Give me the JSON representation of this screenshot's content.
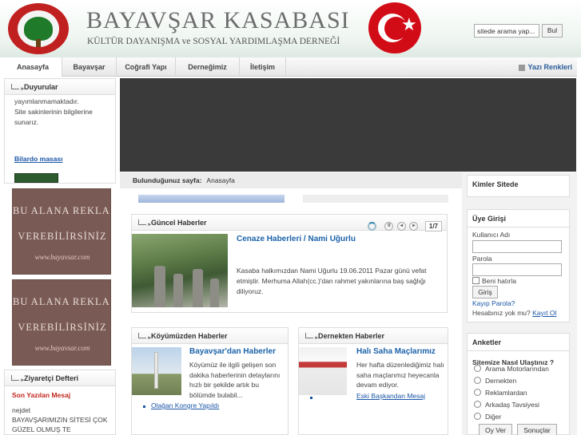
{
  "header": {
    "title": "BAYAVŞAR KASABASI",
    "subtitle": "KÜLTÜR DAYANIŞMA ve SOSYAL YARDIMLAŞMA DERNEĞİ",
    "search_placeholder": "sitede arama yap...",
    "search_button": "Bul"
  },
  "nav": {
    "items": [
      "Anasayfa",
      "Bayavşar",
      "Coğrafi Yapı",
      "Derneğimiz",
      "İletişim"
    ],
    "text_colors_label": "Yazı Renkleri"
  },
  "left": {
    "announcements_title": "Duyurular",
    "announcement_lines": [
      "yayımlanmamaktadır.",
      "Site sakinlerinin bilgilerine",
      "sunarız."
    ],
    "announcement_link": "Bilardo masası",
    "ad": {
      "line1": "BU ALANA REKLAM",
      "line2": "VEREBİLİRSİNİZ",
      "url": "www.bayavsar.com"
    },
    "guestbook_title": "Ziyaretçi Defteri",
    "guestbook_sub": "Son Yazılan Mesaj",
    "guestbook_author": "nejdet",
    "guestbook_msg": "BAYAVŞARIMIZIN SİTESİ ÇOK GÜZEL OLMUŞ TE"
  },
  "breadcrumb": {
    "label": "Bulunduğunuz sayfa:",
    "current": "Anasayfa"
  },
  "news": {
    "title": "Güncel Haberler",
    "page": "1/7",
    "headline": "Cenaze Haberleri / Nami Uğurlu",
    "text": "Kasaba halkımızdan Nami Uğurlu 19.06.2011 Pazar günü vefat etmiştir. Merhuma Allah(cc.)'dan rahmet yakınlarına baş sağlığı diliyoruz."
  },
  "village_news": {
    "title": "Köyümüzden Haberler",
    "headline": "Bayavşar'dan Haberler",
    "text": "Köyümüz ile ilgili gelişen son dakika haberlerinin detaylarını hızlı bir şekilde artık bu bölümde bulabil...",
    "link": "Olağan Kongre Yapıldı"
  },
  "assoc_news": {
    "title": "Dernekten Haberler",
    "headline": "Halı Saha Maçlarımız",
    "text": "Her hafta düzenlediğimiz halı saha maçlarımız heyecanla devam ediyor.",
    "link": "Eski Başkandan Mesaj"
  },
  "right": {
    "online_title": "Kimler Sitede",
    "login_title": "Üye Girişi",
    "username_label": "Kullanıcı Adı",
    "password_label": "Parola",
    "remember_label": "Beni hatırla",
    "login_button": "Giriş",
    "forgot_link": "Kayıp Parola?",
    "no_account_text": "Hesabınız yok mu?",
    "register_link": "Kayıt Ol",
    "poll_title": "Anketler",
    "poll_question": "Sitemize Nasıl Ulaştınız ?",
    "poll_options": [
      "Arama Motorlarından",
      "Dernekten",
      "Reklamlardan",
      "Arkadaş Tavsiyesi",
      "Diğer"
    ],
    "vote_button": "Oy Ver",
    "results_button": "Sonuçlar"
  },
  "colors": {
    "link": "#1b62a9",
    "accent_red": "#c0271d",
    "flag_red": "#d20c17"
  }
}
